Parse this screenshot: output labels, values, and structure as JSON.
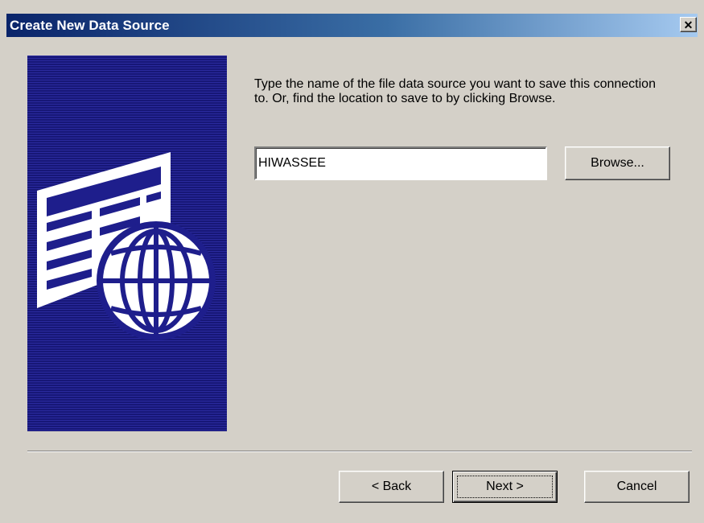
{
  "window": {
    "title": "Create New Data Source",
    "close_glyph": "✕"
  },
  "instructions": "Type the name of the file data source you want to save this connection to.  Or, find the location to save to by clicking Browse.",
  "file_name_input": {
    "value": "HIWASSEE"
  },
  "buttons": {
    "browse": "Browse...",
    "back": "< Back",
    "next": "Next >",
    "cancel": "Cancel"
  },
  "icons": {
    "wizard_art": "data-source-globe-illustration"
  },
  "colors": {
    "title_bar_start": "#0a246a",
    "title_bar_end": "#a6caf0",
    "dialog_face": "#d4d0c8",
    "art_panel": "#1e1e8c"
  }
}
